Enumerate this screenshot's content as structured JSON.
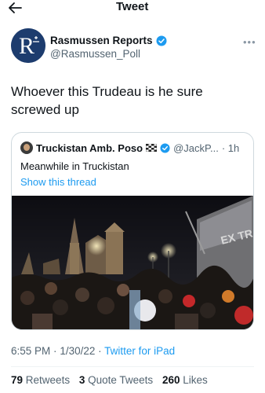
{
  "header": {
    "title": "Tweet",
    "back_icon": "arrow-left-icon"
  },
  "author": {
    "name": "Rasmussen Reports",
    "handle": "@Rasmussen_Poll",
    "avatar_letter": "R",
    "verified": true
  },
  "tweet": {
    "text": "Whoever this Trudeau is he sure screwed up"
  },
  "quote": {
    "name": "Truckistan Amb. Poso",
    "handle": "@JackP...",
    "time": "· 1h",
    "text": "Meanwhile in Truckistan",
    "show_thread": "Show this thread"
  },
  "meta": {
    "time": "6:55 PM",
    "date": "1/30/22",
    "separator": "·",
    "source": "Twitter for iPad"
  },
  "stats": {
    "retweets_count": "79",
    "retweets_label": "Retweets",
    "quotes_count": "3",
    "quotes_label": "Quote Tweets",
    "likes_count": "260",
    "likes_label": "Likes"
  },
  "colors": {
    "accent": "#1d9bf0",
    "text": "#0f1419",
    "muted": "#536471"
  }
}
